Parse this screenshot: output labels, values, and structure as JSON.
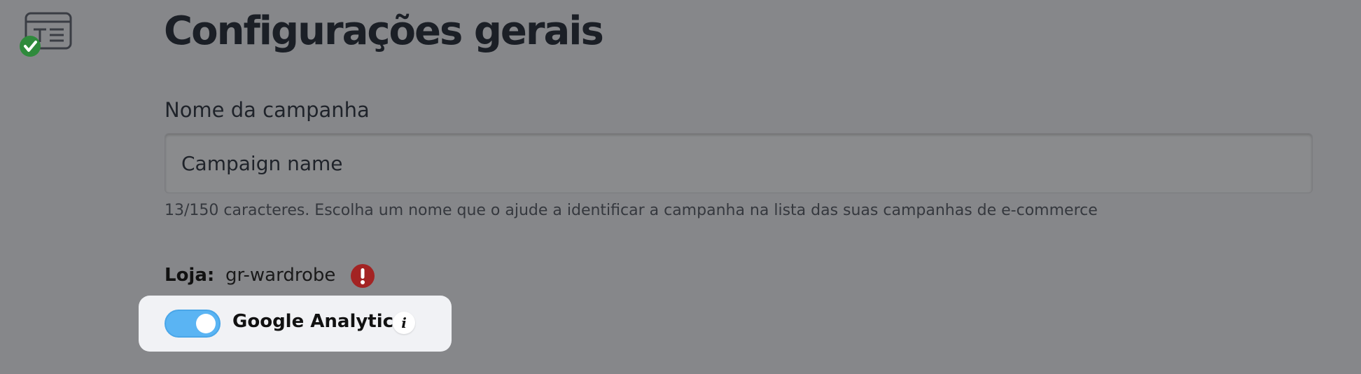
{
  "header": {
    "step_icon": "form-text-check-icon",
    "title": "Configurações gerais"
  },
  "campaign_name": {
    "label": "Nome da campanha",
    "value": "Campaign name",
    "helper": "13/150 caracteres. Escolha um nome que o ajude a identificar a campanha na lista das suas campanhas de e-commerce"
  },
  "store": {
    "label": "Loja:",
    "value": "gr-wardrobe",
    "alert_icon": "exclamation-alert-icon",
    "alert_color": "#a32323"
  },
  "google_analytics": {
    "label": "Google Analytics",
    "enabled": true,
    "toggle_color": "#5ab4f3",
    "info_icon": "info-icon",
    "info_glyph": "i"
  },
  "colors": {
    "overlay_background": "#86878a",
    "check_badge": "#2f8a3c",
    "highlight_card": "#f1f2f5"
  }
}
